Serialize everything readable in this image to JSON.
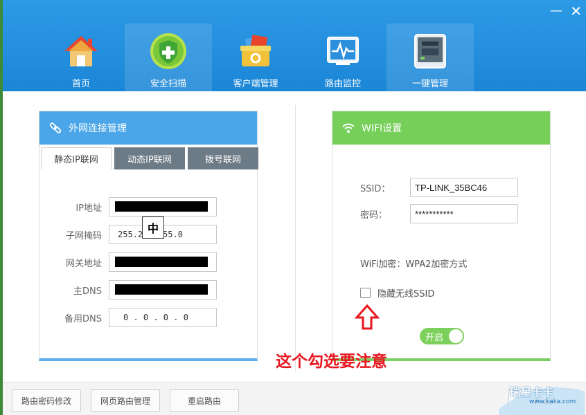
{
  "window": {
    "minimize": "—",
    "close": "✕"
  },
  "nav": [
    {
      "label": "首页",
      "icon": "home-icon"
    },
    {
      "label": "安全扫描",
      "icon": "shield-plus-icon"
    },
    {
      "label": "客户端管理",
      "icon": "client-box-icon"
    },
    {
      "label": "路由监控",
      "icon": "monitor-pulse-icon"
    },
    {
      "label": "一键管理",
      "icon": "router-device-icon"
    }
  ],
  "wan": {
    "title": "外网连接管理",
    "icon": "link-icon",
    "tabs": [
      "静态IP联网",
      "动态IP联网",
      "拨号联网"
    ],
    "fields": [
      {
        "label": "IP地址",
        "value": ""
      },
      {
        "label": "子网掩码",
        "value": "255.255.255.0"
      },
      {
        "label": "网关地址",
        "value": ""
      },
      {
        "label": "主DNS",
        "value": ""
      },
      {
        "label": "备用DNS",
        "value": "0 . 0 . 0 . 0"
      }
    ],
    "ime": "中"
  },
  "wifi": {
    "title": "WIFI设置",
    "icon": "wifi-icon",
    "ssid_label": "SSID：",
    "ssid_value": "TP-LINK_35BC46",
    "password_label": "密码：",
    "password_value": "***********",
    "encryption_label": "WiFi加密：",
    "encryption_value": "WPA2加密方式",
    "hide_ssid_label": "隐藏无线SSID",
    "toggle_label": "开启"
  },
  "annotation": "这个勾选要注意",
  "footer": {
    "buttons": [
      "路由密码修改",
      "网页路由管理",
      "重启路由"
    ],
    "watermark_text": "瑞星卡卡",
    "watermark_url": "www.kaka.com",
    "right_partial": "开  启"
  },
  "colors": {
    "header": "#1b86d6",
    "wan_head": "#4aa6e8",
    "wifi_head": "#76cf58",
    "annotation": "#e8161f"
  }
}
